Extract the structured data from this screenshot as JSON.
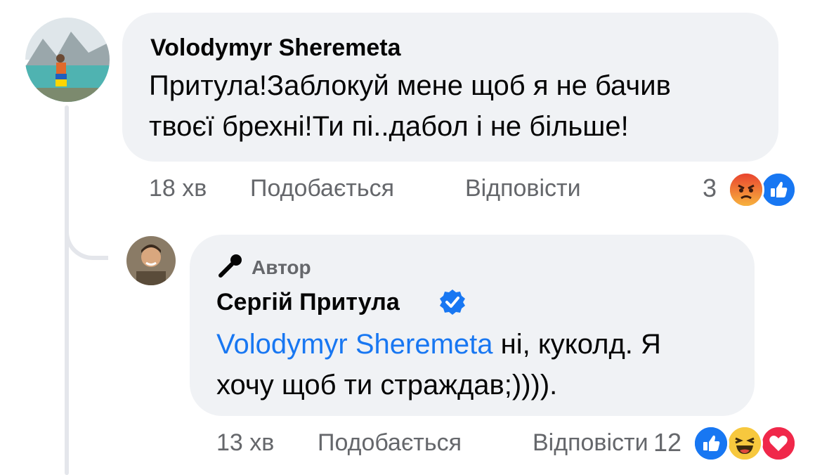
{
  "comment": {
    "author": "Volodymyr Sheremeta",
    "text_line1": "Притула!Заблокуй мене щоб я не бачив",
    "text_line2": "твоєї брехні!Ти пі..дабол і не більше!",
    "time": "18 хв",
    "like_label": "Подобається",
    "reply_label": "Відповісти",
    "reaction_count": "3",
    "reactions": [
      "angry-icon",
      "like-icon"
    ]
  },
  "reply": {
    "badge_icon": "microphone-icon",
    "badge_label": "Автор",
    "author": "Сергій Притула",
    "verified_icon": "verified-badge-icon",
    "mention": "Volodymyr Sheremeta",
    "text_after_mention": " ні, куколд. Я",
    "text_line2": "хочу щоб ти страждав;)))).",
    "time": "13 хв",
    "like_label": "Подобається",
    "reply_label": "Відповісти",
    "reaction_count": "12",
    "reactions": [
      "like-icon",
      "haha-icon",
      "love-icon"
    ]
  },
  "colors": {
    "bubble_bg": "#f0f2f5",
    "meta_text": "#65676b",
    "link_blue": "#1877f2",
    "thread_line": "#e4e6eb"
  }
}
